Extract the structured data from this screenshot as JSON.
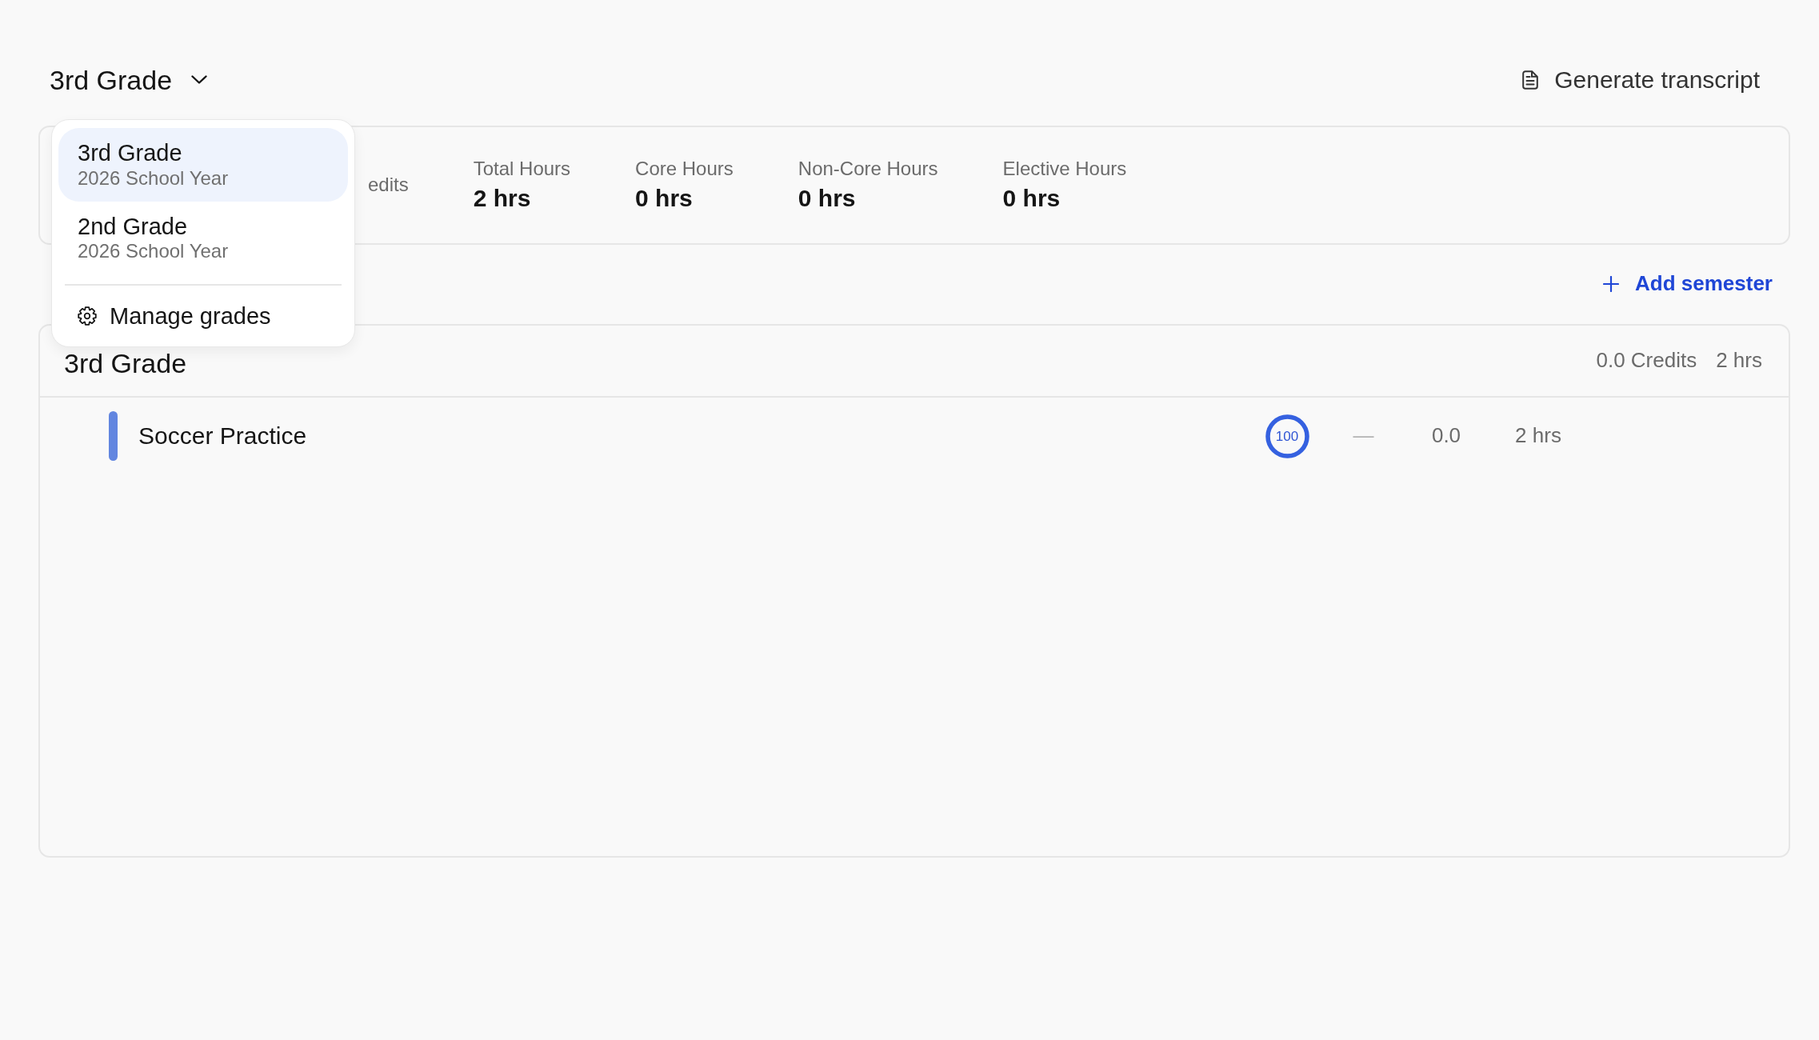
{
  "header": {
    "grade_selector": {
      "label": "3rd Grade",
      "expanded": true
    },
    "transcript_button": {
      "label": "Generate transcript"
    }
  },
  "grade_menu": {
    "options": [
      {
        "title": "3rd Grade",
        "subtitle": "2026 School Year",
        "selected": true
      },
      {
        "title": "2nd Grade",
        "subtitle": "2026 School Year",
        "selected": false
      }
    ],
    "actions": [
      {
        "label": "Manage grades"
      }
    ]
  },
  "summary": {
    "stats": [
      {
        "label": "edits"
      },
      {
        "label": "Total Hours",
        "value": "2 hrs"
      },
      {
        "label": "Core Hours",
        "value": "0 hrs"
      },
      {
        "label": "Non-Core Hours",
        "value": "0 hrs"
      },
      {
        "label": "Elective Hours",
        "value": "0 hrs"
      }
    ]
  },
  "add_semester": {
    "label": "Add semester"
  },
  "semesters": [
    {
      "title": "3rd Grade",
      "credits": "0.0 Credits",
      "hours": "2 hrs",
      "courses": [
        {
          "name": "Soccer Practice",
          "color": "#6286e0",
          "score": "100",
          "level": 1,
          "grade": "—",
          "credits": "0.0",
          "hours": "2 hrs"
        }
      ]
    }
  ]
}
